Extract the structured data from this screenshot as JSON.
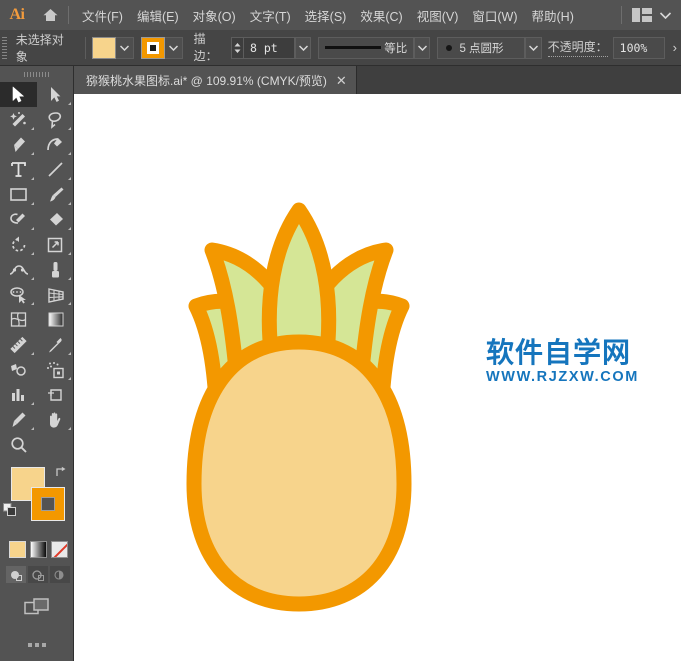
{
  "app": {
    "name": "Ai",
    "logo_color": "#f29b3d",
    "ui_bg": "#535353",
    "panel_bg": "#454545"
  },
  "menubar": {
    "home_icon": "home-icon",
    "items": [
      {
        "label": "文件(F)"
      },
      {
        "label": "编辑(E)"
      },
      {
        "label": "对象(O)"
      },
      {
        "label": "文字(T)"
      },
      {
        "label": "选择(S)"
      },
      {
        "label": "效果(C)"
      },
      {
        "label": "视图(V)"
      },
      {
        "label": "窗口(W)"
      },
      {
        "label": "帮助(H)"
      }
    ],
    "workspace_icon": "workspace-layout-icon",
    "workspace_chevron": "chevron-down-icon"
  },
  "controlbar": {
    "grip": "panel-grip",
    "selection_status": "未选择对象",
    "fill": {
      "label": "fill-swatch",
      "color": "#f7d48c",
      "chevron": "chevron-down-icon"
    },
    "stroke": {
      "label": "stroke-swatch",
      "color": "#f39800",
      "chevron": "chevron-down-icon"
    },
    "stroke_weight": {
      "label": "描边：",
      "value": "8 pt",
      "chevron": "chevron-down-icon"
    },
    "line_profile": {
      "value": "等比",
      "chevron": "chevron-down-icon"
    },
    "brush_profile": {
      "value": "5 点圆形",
      "chevron": "chevron-down-icon"
    },
    "opacity": {
      "label": "不透明度：",
      "value": "100%"
    },
    "overflow_arrow": "›"
  },
  "tabbar": {
    "tabs": [
      {
        "title": "猕猴桃水果图标.ai* @ 109.91% (CMYK/预览)",
        "close": "✕",
        "active": true
      }
    ]
  },
  "toolbar": {
    "tools": [
      {
        "name": "selection-tool",
        "active": true,
        "has_flyout": false
      },
      {
        "name": "direct-selection-tool",
        "active": false,
        "has_flyout": true
      },
      {
        "name": "magic-wand-tool",
        "active": false,
        "has_flyout": true
      },
      {
        "name": "lasso-tool",
        "active": false,
        "has_flyout": true
      },
      {
        "name": "pen-tool",
        "active": false,
        "has_flyout": true
      },
      {
        "name": "curvature-tool",
        "active": false,
        "has_flyout": true
      },
      {
        "name": "type-tool",
        "active": false,
        "has_flyout": true
      },
      {
        "name": "line-segment-tool",
        "active": false,
        "has_flyout": true
      },
      {
        "name": "rectangle-tool",
        "active": false,
        "has_flyout": true
      },
      {
        "name": "paintbrush-tool",
        "active": false,
        "has_flyout": true
      },
      {
        "name": "shaper-tool",
        "active": false,
        "has_flyout": true
      },
      {
        "name": "eraser-tool",
        "active": false,
        "has_flyout": true
      },
      {
        "name": "rotate-tool",
        "active": false,
        "has_flyout": true
      },
      {
        "name": "scale-tool",
        "active": false,
        "has_flyout": true
      },
      {
        "name": "width-tool",
        "active": false,
        "has_flyout": true
      },
      {
        "name": "free-transform-tool",
        "active": false,
        "has_flyout": true
      },
      {
        "name": "shape-builder-tool",
        "active": false,
        "has_flyout": true
      },
      {
        "name": "perspective-grid-tool",
        "active": false,
        "has_flyout": true
      },
      {
        "name": "mesh-tool",
        "active": false,
        "has_flyout": false
      },
      {
        "name": "gradient-tool",
        "active": false,
        "has_flyout": false
      },
      {
        "name": "measure-tool",
        "active": false,
        "has_flyout": true
      },
      {
        "name": "eyedropper-tool",
        "active": false,
        "has_flyout": true
      },
      {
        "name": "blend-tool",
        "active": false,
        "has_flyout": false
      },
      {
        "name": "symbol-sprayer-tool",
        "active": false,
        "has_flyout": true
      },
      {
        "name": "column-graph-tool",
        "active": false,
        "has_flyout": true
      },
      {
        "name": "artboard-tool",
        "active": false,
        "has_flyout": false
      },
      {
        "name": "slice-tool",
        "active": false,
        "has_flyout": true
      },
      {
        "name": "hand-tool",
        "active": false,
        "has_flyout": true
      },
      {
        "name": "zoom-tool",
        "active": false,
        "has_flyout": false
      }
    ],
    "color_controls": {
      "fill_color": "#f7d48c",
      "stroke_color": "#f39800",
      "swap_icon": "swap-fill-stroke-icon",
      "default_icon": "default-fill-stroke-icon",
      "fill_modes": [
        {
          "name": "color-mode-button",
          "selected": true
        },
        {
          "name": "gradient-mode-button",
          "selected": false
        },
        {
          "name": "none-mode-button",
          "selected": false
        }
      ],
      "draw_modes": [
        {
          "name": "draw-normal-button",
          "selected": true
        },
        {
          "name": "draw-behind-button",
          "selected": false
        },
        {
          "name": "draw-inside-button",
          "selected": false
        }
      ],
      "screen_mode": "change-screen-mode-icon",
      "more_tools": "edit-toolbar-icon"
    }
  },
  "canvas": {
    "background": "#ffffff",
    "artwork": {
      "name": "pineapple-icon",
      "body_fill": "#f7d48c",
      "leaf_fill": "#d5e696",
      "stroke": "#f39800",
      "stroke_width": 14
    },
    "watermark": {
      "chinese": "软件自学网",
      "url": "WWW.RJZXW.COM",
      "color": "#1575bd"
    }
  }
}
